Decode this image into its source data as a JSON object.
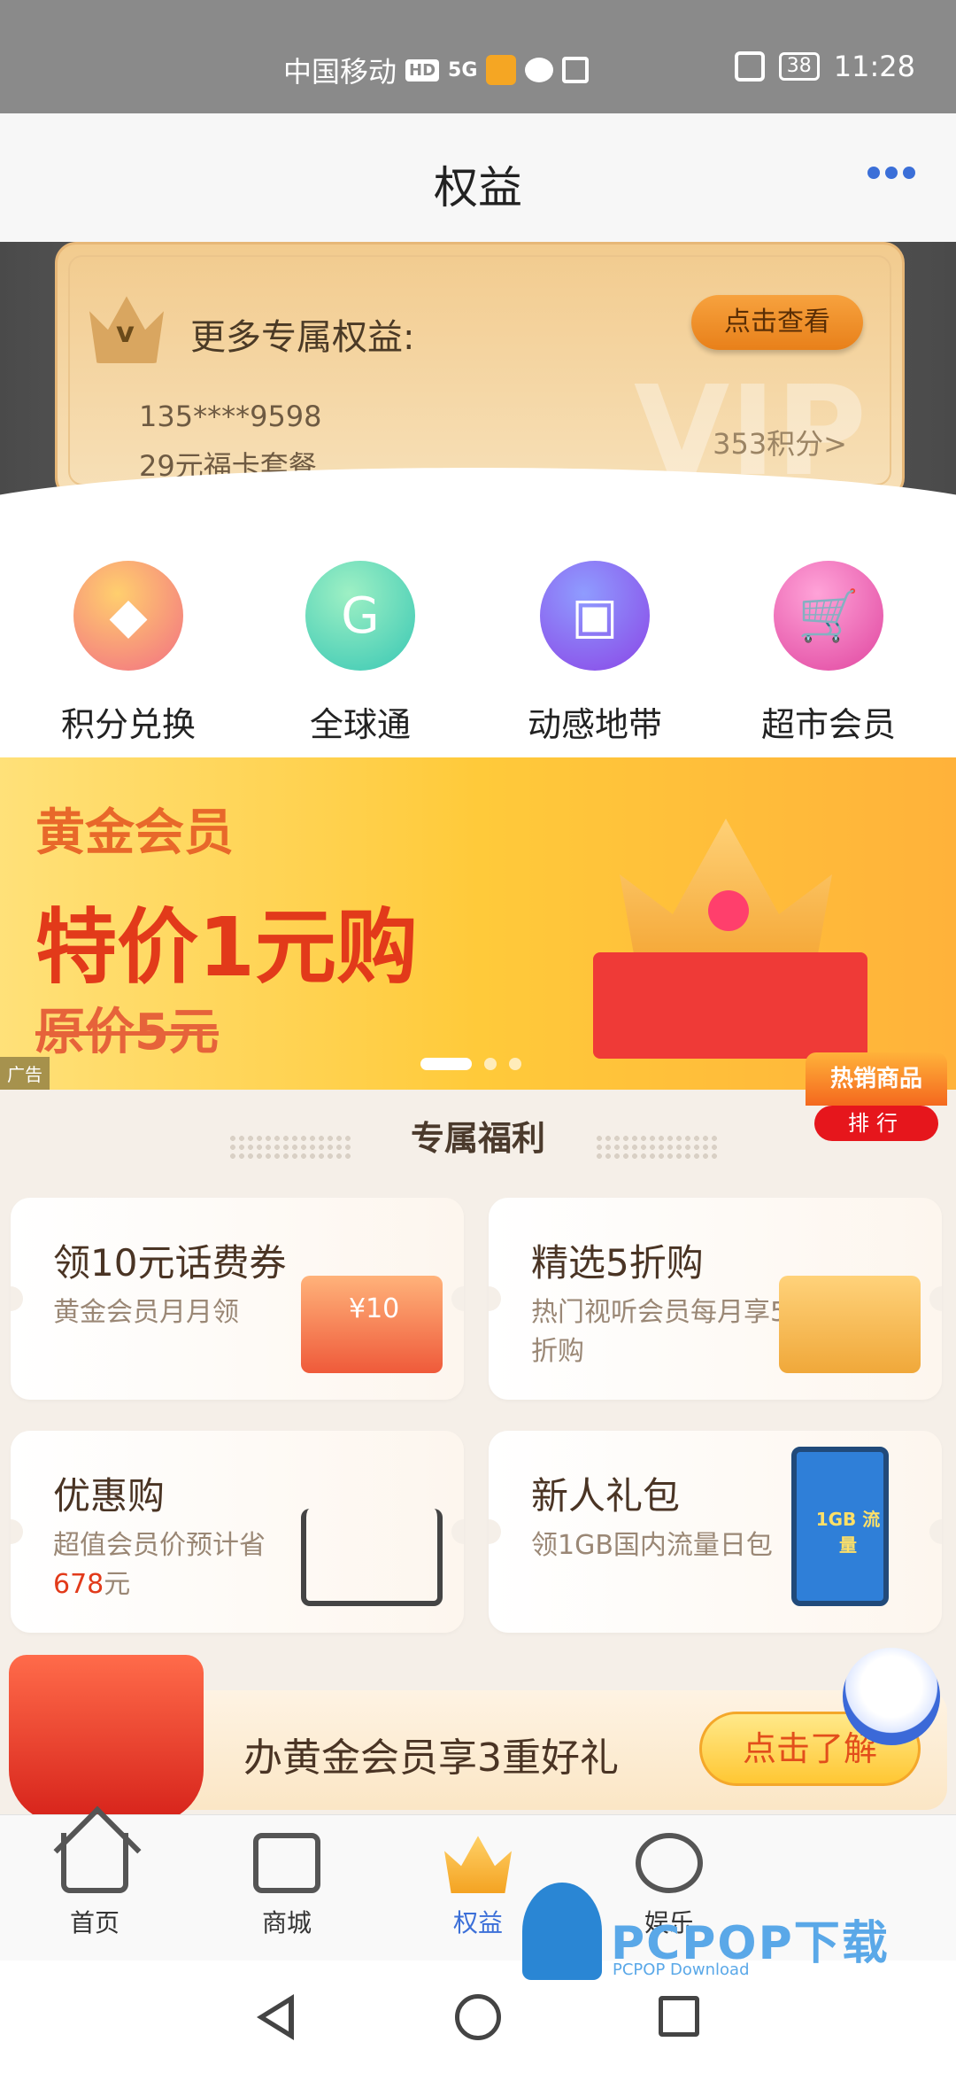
{
  "status_bar": {
    "carrier": "中国移动",
    "hd_badge": "HD",
    "signal": "5G",
    "battery": "38",
    "time": "11:28"
  },
  "header": {
    "title": "权益",
    "more_icon": "more-dots-icon"
  },
  "vip_card": {
    "title": "更多专属权益:",
    "button_label": "点击查看",
    "phone": "135****9598",
    "plan": "29元福卡套餐",
    "points": "353积分>",
    "watermark": "VIP"
  },
  "quick_links": [
    {
      "label": "积分兑换",
      "icon": "diamond-icon"
    },
    {
      "label": "全球通",
      "icon": "global-icon"
    },
    {
      "label": "动感地带",
      "icon": "gift-icon"
    },
    {
      "label": "超市会员",
      "icon": "cart-icon"
    }
  ],
  "ad_banner": {
    "line1": "黄金会员",
    "line2": "特价1元购",
    "line3": "原价5元",
    "tag": "广告",
    "slide_count": 3,
    "active_slide": 1
  },
  "hot_badge": {
    "top": "热销商品",
    "bottom": "排行"
  },
  "section": {
    "title": "专属福利"
  },
  "benefits": [
    {
      "title": "领10元话费券",
      "subtitle": "黄金会员月月领",
      "art_text": "¥10"
    },
    {
      "title": "精选5折购",
      "subtitle": "热门视听会员每月享5折购"
    },
    {
      "title": "优惠购",
      "subtitle_prefix": "超值会员价预计省",
      "subtitle_value": "678",
      "subtitle_suffix": "元"
    },
    {
      "title": "新人礼包",
      "subtitle": "领1GB国内流量日包",
      "art_text": "1GB 流量"
    }
  ],
  "promo": {
    "text": "办黄金会员享3重好礼",
    "button_label": "点击了解"
  },
  "bottom_nav": [
    {
      "label": "首页",
      "active": false
    },
    {
      "label": "商城",
      "active": false
    },
    {
      "label": "权益",
      "active": true
    },
    {
      "label": "娱乐",
      "active": false
    }
  ],
  "watermark": {
    "brand": "PCPOP下载",
    "sub": "PCPOP Download"
  }
}
